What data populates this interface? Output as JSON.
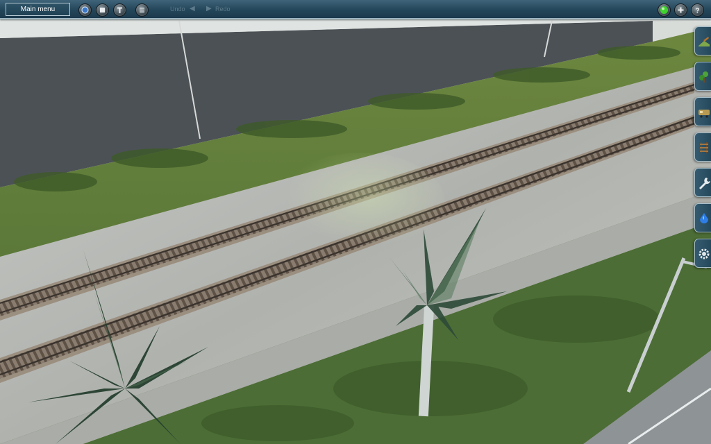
{
  "toolbar": {
    "main_menu_label": "Main menu",
    "undo_label": "Undo",
    "redo_label": "Redo",
    "left_buttons": [
      "globe-icon",
      "stop-icon",
      "info-icon",
      "layers-icon"
    ],
    "right_buttons": [
      "status-light-icon",
      "plus-icon",
      "help-icon"
    ]
  },
  "side_panel": {
    "tools": [
      "terrain-tool",
      "scenery-tool",
      "train-tool",
      "track-tool",
      "wrench-tool",
      "water-tool",
      "settings-tool"
    ]
  },
  "colors": {
    "toolbar": "#24465a",
    "grass": "#5c7a35",
    "gravel": "#b6b8b4",
    "rail": "#7a6a5a"
  }
}
